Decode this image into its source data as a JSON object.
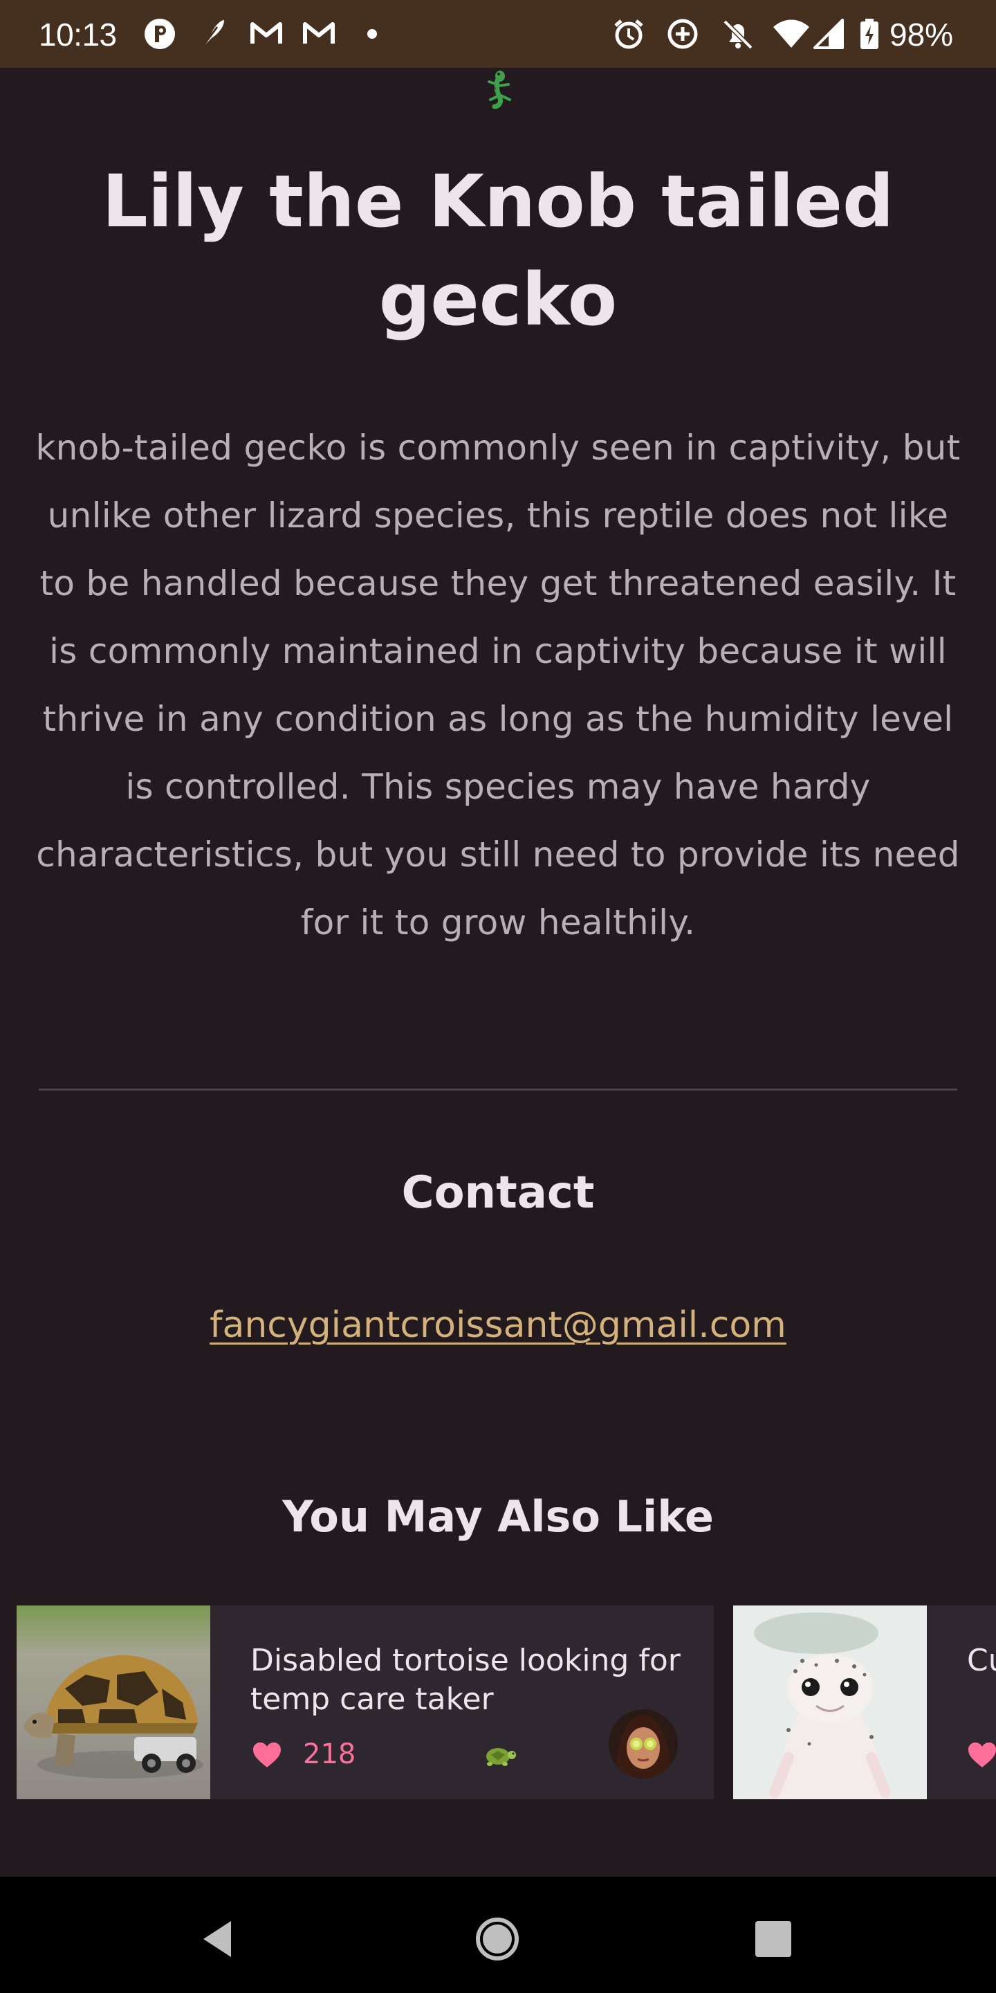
{
  "status_bar": {
    "time": "10:13",
    "battery_text": "98%",
    "left_icons": [
      "p-app-icon",
      "feather-icon",
      "gmail-icon",
      "gmail-icon",
      "more-notifications-dot-icon"
    ],
    "right_icons": [
      "alarm-icon",
      "data-saver-icon",
      "notifications-off-icon",
      "wifi-icon",
      "signal-icon",
      "battery-charging-icon"
    ],
    "background": "#45301f"
  },
  "page": {
    "emoji_icon": "gecko-emoji-icon",
    "title": "Lily the Knob tailed gecko",
    "description": "knob-tailed gecko is commonly seen in captivity, but unlike other lizard species, this reptile does not like to be handled because they get threatened easily. It is commonly maintained in captivity because it will thrive in any condition as long as the humidity level is controlled. This species may have hardy characteristics, but you still need to provide its need for it to grow healthily.",
    "contact_heading": "Contact",
    "contact_email": "fancygiantcroissant@gmail.com",
    "also_like_heading": "You May Also Like"
  },
  "cards": [
    {
      "title": "Disabled tortoise looking for temp care taker",
      "likes": "218",
      "image": "tortoise-photo",
      "species_icon": "turtle-icon",
      "avatar": "user-avatar"
    },
    {
      "title": "Cu",
      "image": "leopard-gecko-photo"
    }
  ],
  "nav_bar": {
    "buttons": [
      "back-icon",
      "home-icon",
      "recents-icon"
    ]
  },
  "colors": {
    "background": "#221a1f",
    "card": "#2f2730",
    "accent_link": "#d3b37a",
    "like_pink": "#ff6f98",
    "heading": "#ece6ea",
    "body_text": "#b8b0b6"
  }
}
